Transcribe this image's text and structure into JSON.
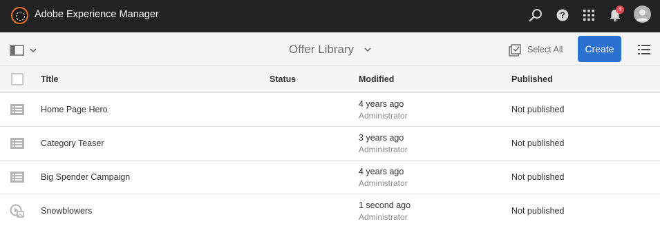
{
  "shell": {
    "app_title": "Adobe Experience Manager",
    "notification_count": "4",
    "icons": [
      "search-icon",
      "help-icon",
      "apps-grid-icon",
      "bell-icon",
      "user-avatar-icon"
    ]
  },
  "actionbar": {
    "library_title": "Offer Library",
    "select_all_label": "Select All",
    "create_label": "Create"
  },
  "table": {
    "columns": {
      "title": "Title",
      "status": "Status",
      "modified": "Modified",
      "published": "Published"
    },
    "rows": [
      {
        "title": "Home Page Hero",
        "status": "",
        "modified": "4 years ago",
        "modified_by": "Administrator",
        "published": "Not published",
        "icon": "offer-list-icon"
      },
      {
        "title": "Category Teaser",
        "status": "",
        "modified": "3 years ago",
        "modified_by": "Administrator",
        "published": "Not published",
        "icon": "offer-list-icon"
      },
      {
        "title": "Big Spender Campaign",
        "status": "",
        "modified": "4 years ago",
        "modified_by": "Administrator",
        "published": "Not published",
        "icon": "offer-list-icon"
      },
      {
        "title": "Snowblowers",
        "status": "",
        "modified": "1 second ago",
        "modified_by": "Administrator",
        "published": "Not published",
        "icon": "media-offer-icon"
      }
    ]
  },
  "colors": {
    "shell_bg": "#222222",
    "accent": "#2d71d0",
    "logo_ring": "#e8702a",
    "badge": "#e34850"
  }
}
